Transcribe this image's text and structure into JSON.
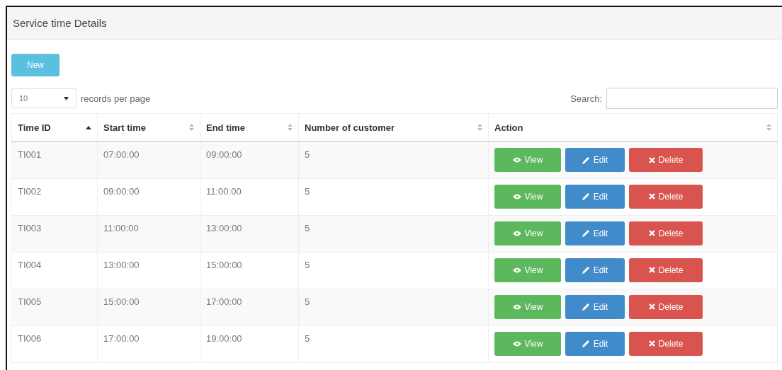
{
  "panel": {
    "title": "Service time Details"
  },
  "new_button": "New",
  "page_size": {
    "value": "10",
    "label": "records per page"
  },
  "search": {
    "label": "Search:"
  },
  "table": {
    "columns": [
      {
        "label": "Time ID",
        "sorted": true
      },
      {
        "label": "Start time",
        "sorted": false
      },
      {
        "label": "End time",
        "sorted": false
      },
      {
        "label": "Number of customer",
        "sorted": false
      },
      {
        "label": "Action",
        "sorted": false
      }
    ],
    "rows": [
      {
        "cells": [
          "TI001",
          "07:00:00",
          "09:00:00",
          "5"
        ],
        "actions": [
          {
            "kind": "view",
            "label": "View"
          },
          {
            "kind": "edit",
            "label": "Edit"
          },
          {
            "kind": "delete",
            "label": "Delete"
          }
        ]
      },
      {
        "cells": [
          "TI002",
          "09:00:00",
          "11:00:00",
          "5"
        ],
        "actions": [
          {
            "kind": "view",
            "label": "View"
          },
          {
            "kind": "edit",
            "label": "Edit"
          },
          {
            "kind": "delete",
            "label": "Delete"
          }
        ]
      },
      {
        "cells": [
          "TI003",
          "11:00:00",
          "13:00:00",
          "5"
        ],
        "actions": [
          {
            "kind": "view",
            "label": "View"
          },
          {
            "kind": "edit",
            "label": "Edit"
          },
          {
            "kind": "delete",
            "label": "Delete"
          }
        ]
      },
      {
        "cells": [
          "TI004",
          "13:00:00",
          "15:00:00",
          "5"
        ],
        "actions": [
          {
            "kind": "view",
            "label": "View"
          },
          {
            "kind": "edit",
            "label": "Edit"
          },
          {
            "kind": "delete",
            "label": "Delete"
          }
        ]
      },
      {
        "cells": [
          "TI005",
          "15:00:00",
          "17:00:00",
          "5"
        ],
        "actions": [
          {
            "kind": "view",
            "label": "View"
          },
          {
            "kind": "edit",
            "label": "Edit"
          },
          {
            "kind": "delete",
            "label": "Delete"
          }
        ]
      },
      {
        "cells": [
          "TI006",
          "17:00:00",
          "19:00:00",
          "5"
        ],
        "actions": [
          {
            "kind": "view",
            "label": "View"
          },
          {
            "kind": "edit",
            "label": "Edit"
          },
          {
            "kind": "delete",
            "label": "Delete"
          }
        ]
      }
    ]
  }
}
